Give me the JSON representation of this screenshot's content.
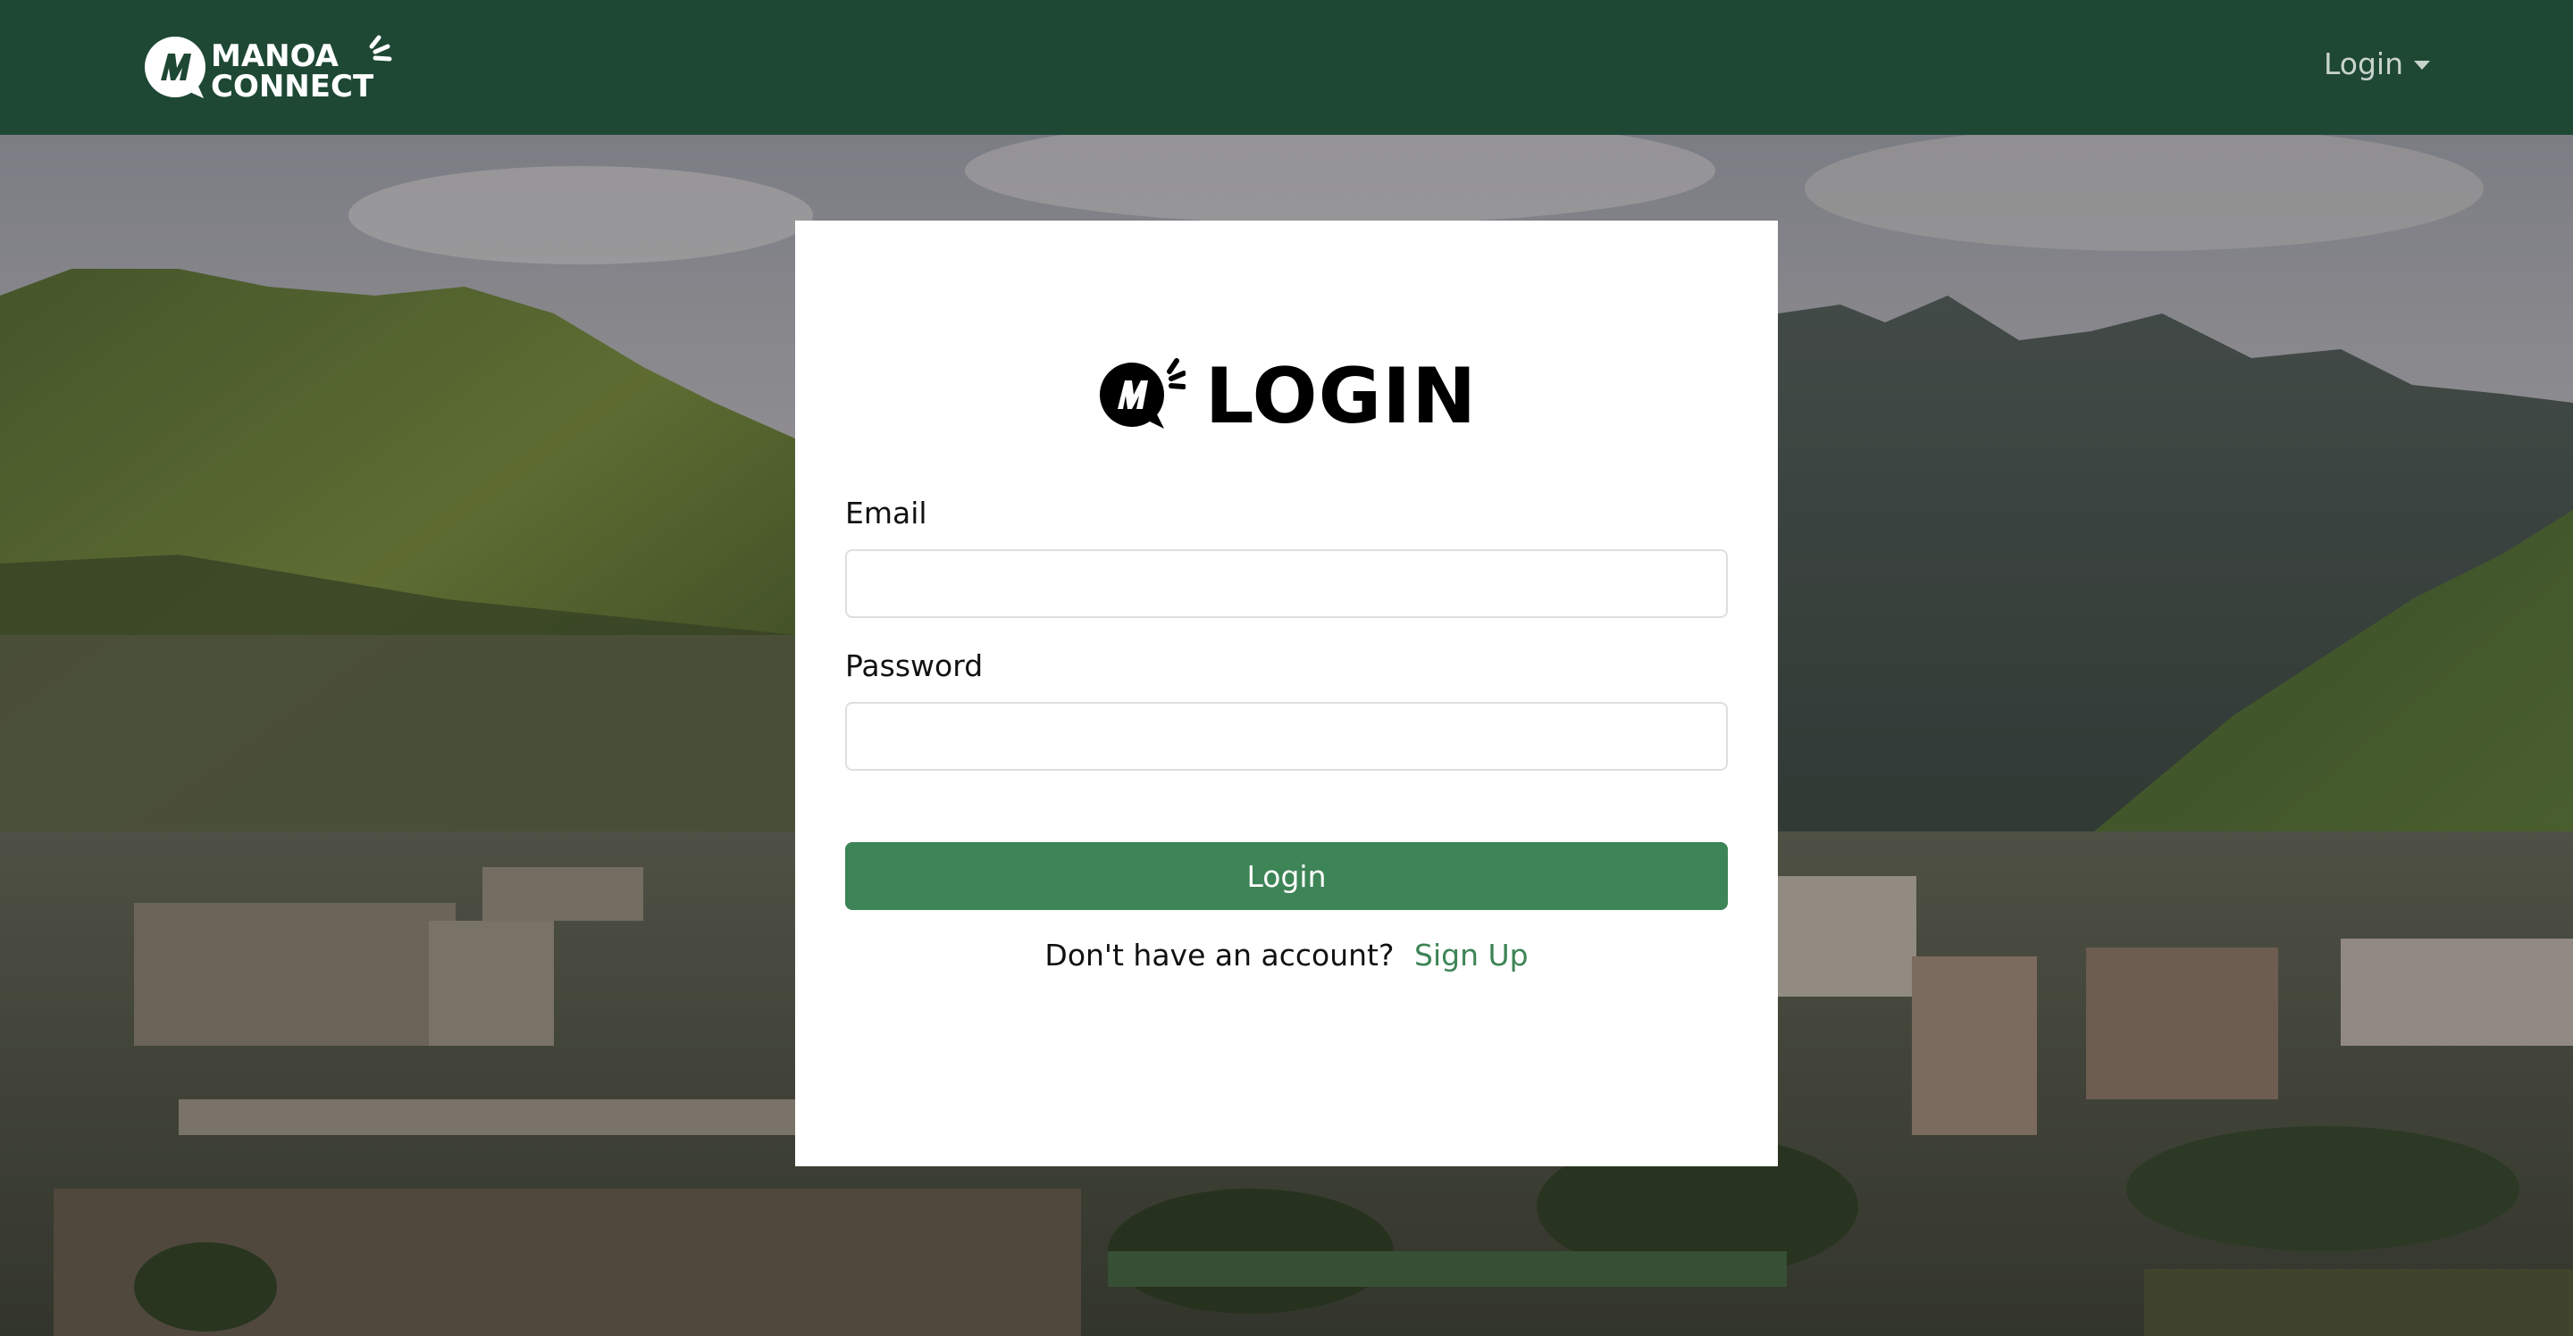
{
  "navbar": {
    "brand_line1": "MANOA",
    "brand_line2": "CONNECT",
    "login_menu_label": "Login",
    "brand_color": "#1e4834"
  },
  "login_card": {
    "title": "LOGIN",
    "email_label": "Email",
    "email_value": "",
    "password_label": "Password",
    "password_value": "",
    "submit_label": "Login",
    "signup_prompt": "Don't have an account?",
    "signup_link": "Sign Up",
    "accent_color": "#3d8456"
  },
  "icons": {
    "brand_logo": "manoa-connect-logo-icon",
    "title_logo": "chat-bubble-m-icon",
    "dropdown": "caret-down-icon"
  }
}
